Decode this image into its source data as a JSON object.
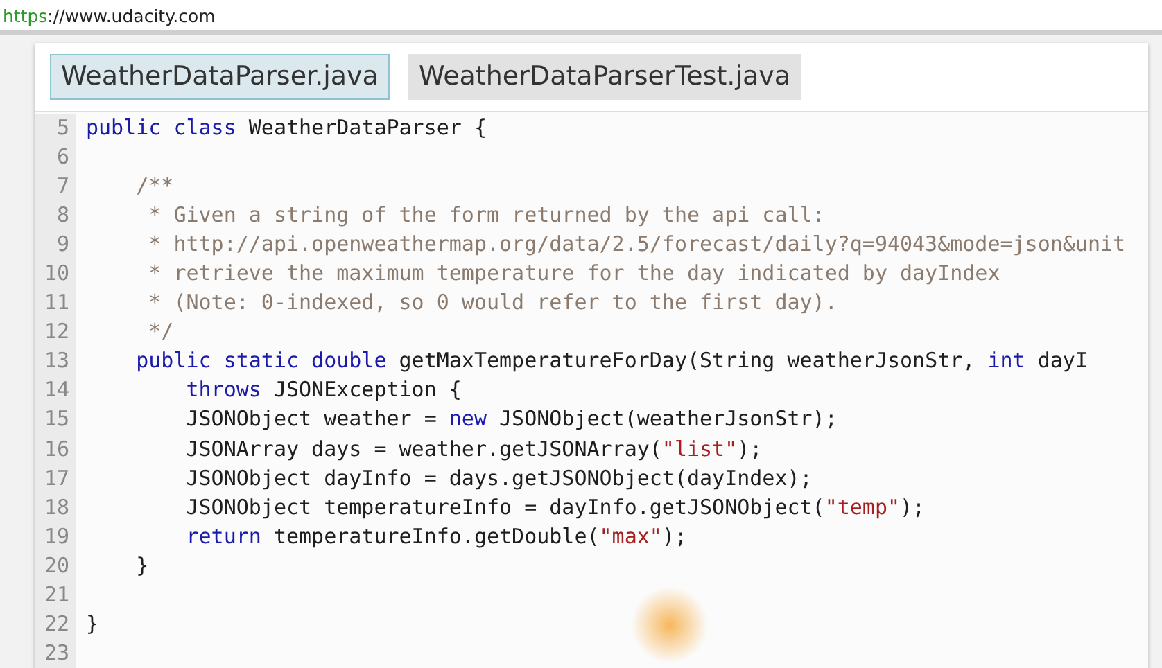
{
  "address_bar": {
    "scheme": "https",
    "rest": "://www.udacity.com"
  },
  "tabs": [
    {
      "label": "WeatherDataParser.java",
      "selected": true
    },
    {
      "label": "WeatherDataParserTest.java",
      "selected": false
    }
  ],
  "code": [
    {
      "number": "5",
      "tokens": [
        {
          "kind": "keyword",
          "text": "public class"
        },
        {
          "kind": "plain",
          "text": " WeatherDataParser {"
        }
      ]
    },
    {
      "number": "6"
    },
    {
      "number": "7",
      "tokens": [
        {
          "kind": "comment",
          "text": "    /**"
        }
      ]
    },
    {
      "number": "8",
      "tokens": [
        {
          "kind": "comment",
          "text": "     * Given a string of the form returned by the api call:"
        }
      ]
    },
    {
      "number": "9",
      "tokens": [
        {
          "kind": "comment",
          "text": "     * http://api.openweathermap.org/data/2.5/forecast/daily?q=94043&mode=json&unit"
        }
      ]
    },
    {
      "number": "10",
      "tokens": [
        {
          "kind": "comment",
          "text": "     * retrieve the maximum temperature for the day indicated by dayIndex"
        }
      ]
    },
    {
      "number": "11",
      "tokens": [
        {
          "kind": "comment",
          "text": "     * (Note: 0-indexed, so 0 would refer to the first day)."
        }
      ]
    },
    {
      "number": "12",
      "tokens": [
        {
          "kind": "comment",
          "text": "     */"
        }
      ]
    },
    {
      "number": "13",
      "tokens": [
        {
          "kind": "keyword",
          "text": "    public static double"
        },
        {
          "kind": "plain",
          "text": " getMaxTemperatureForDay(String weatherJsonStr, "
        },
        {
          "kind": "keyword",
          "text": "int"
        },
        {
          "kind": "plain",
          "text": " dayI"
        }
      ]
    },
    {
      "number": "14",
      "tokens": [
        {
          "kind": "keyword",
          "text": "        throws"
        },
        {
          "kind": "plain",
          "text": " JSONException {"
        }
      ]
    },
    {
      "number": "15",
      "tokens": [
        {
          "kind": "plain",
          "text": "        JSONObject weather = "
        },
        {
          "kind": "keyword",
          "text": "new"
        },
        {
          "kind": "plain",
          "text": " JSONObject(weatherJsonStr);"
        }
      ]
    },
    {
      "number": "16",
      "tokens": [
        {
          "kind": "plain",
          "text": "        JSONArray days = weather.getJSONArray("
        },
        {
          "kind": "string",
          "text": "\"list\""
        },
        {
          "kind": "plain",
          "text": ");"
        }
      ]
    },
    {
      "number": "17",
      "tokens": [
        {
          "kind": "plain",
          "text": "        JSONObject dayInfo = days.getJSONObject(dayIndex);"
        }
      ]
    },
    {
      "number": "18",
      "tokens": [
        {
          "kind": "plain",
          "text": "        JSONObject temperatureInfo = dayInfo.getJSONObject("
        },
        {
          "kind": "string",
          "text": "\"temp\""
        },
        {
          "kind": "plain",
          "text": ");"
        }
      ]
    },
    {
      "number": "19",
      "tokens": [
        {
          "kind": "keyword",
          "text": "        return"
        },
        {
          "kind": "plain",
          "text": " temperatureInfo.getDouble("
        },
        {
          "kind": "string",
          "text": "\"max\""
        },
        {
          "kind": "plain",
          "text": ");"
        }
      ]
    },
    {
      "number": "20",
      "tokens": [
        {
          "kind": "plain",
          "text": "    }"
        }
      ]
    },
    {
      "number": "21"
    },
    {
      "number": "22",
      "tokens": [
        {
          "kind": "plain",
          "text": "}"
        }
      ]
    },
    {
      "number": "23"
    }
  ]
}
